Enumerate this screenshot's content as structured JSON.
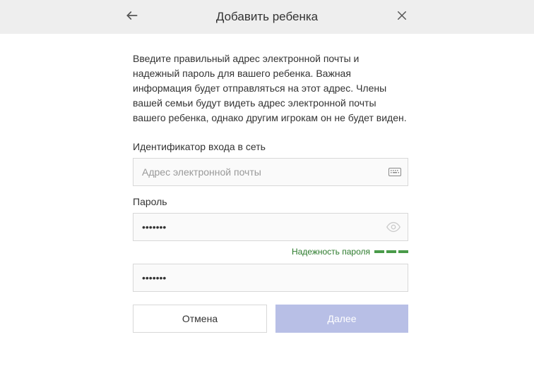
{
  "header": {
    "title": "Добавить ребенка"
  },
  "intro_text": "Введите правильный адрес электронной почты и надежный пароль для вашего ребенка. Важная информация будет отправляться на этот адрес. Члены вашей семьи будут видеть адрес электронной почты вашего ребенка, однако другим игрокам он не будет виден.",
  "email": {
    "label": "Идентификатор входа в сеть",
    "placeholder": "Адрес электронной почты",
    "value": ""
  },
  "password": {
    "label": "Пароль",
    "value": "•••••••",
    "strength_label": "Надежность пароля",
    "confirm_value": "•••••••"
  },
  "buttons": {
    "cancel": "Отмена",
    "next": "Далее"
  }
}
